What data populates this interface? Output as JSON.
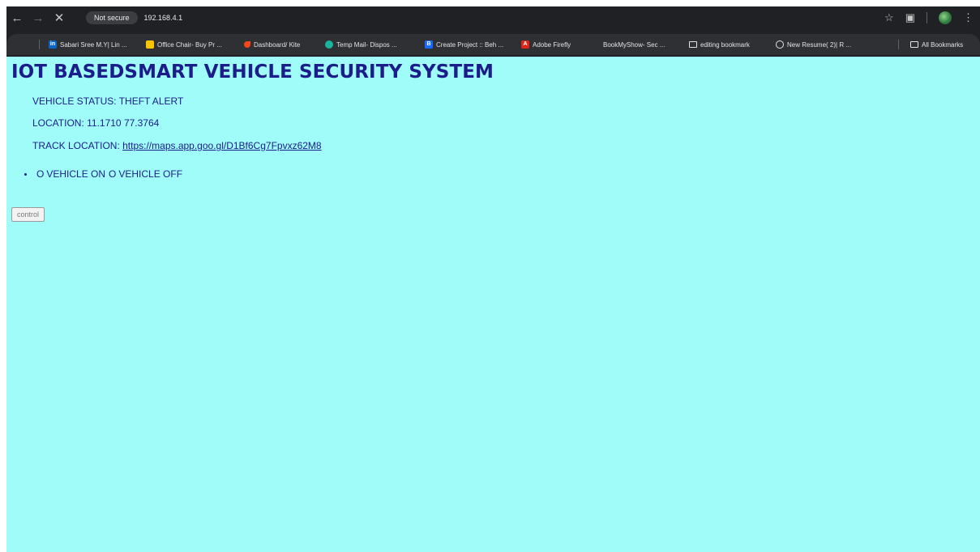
{
  "browser": {
    "security_label": "Not secure",
    "url": "192.168.4.1",
    "bookmarks": [
      {
        "label": "Sabari Sree M.Y| Lin ...",
        "icon": "linkedin-icon",
        "color": "#0a66c2"
      },
      {
        "label": "Office Chair- Buy Pr ...",
        "icon": "flipkart-icon",
        "color": "#f7c600"
      },
      {
        "label": "Dashboard/ Kite",
        "icon": "kite-icon",
        "color": "#f6461a"
      },
      {
        "label": "Temp Mail- Dispos ...",
        "icon": "tempmail-icon",
        "color": "#18b4a0"
      },
      {
        "label": "Create Project :: Beh ...",
        "icon": "behance-icon",
        "color": "#1769ff"
      },
      {
        "label": "Adobe Firefly",
        "icon": "adobe-icon",
        "color": "#e1251b"
      },
      {
        "label": "BookMyShow- Sec ...",
        "icon": "",
        "color": ""
      },
      {
        "label": "editing bookmark",
        "icon": "folder-icon",
        "color": ""
      },
      {
        "label": "New Resume( 2)| R ...",
        "icon": "globe-icon",
        "color": ""
      }
    ],
    "all_bookmarks_label": "All Bookmarks"
  },
  "page": {
    "title": "IOT BASEDSMART VEHICLE SECURITY SYSTEM",
    "status": "VEHICLE STATUS: THEFT ALERT",
    "location": "LOCATION: 11.1710 77.3764",
    "track_prefix": "TRACK LOCATION: ",
    "track_link": "https://maps.app.goo.gl/D1Bf6Cg7Fpvxz62M8",
    "radio_on_label": "VEHICLE ON",
    "radio_off_label": "VEHICLE OFF",
    "control_button": "control"
  }
}
